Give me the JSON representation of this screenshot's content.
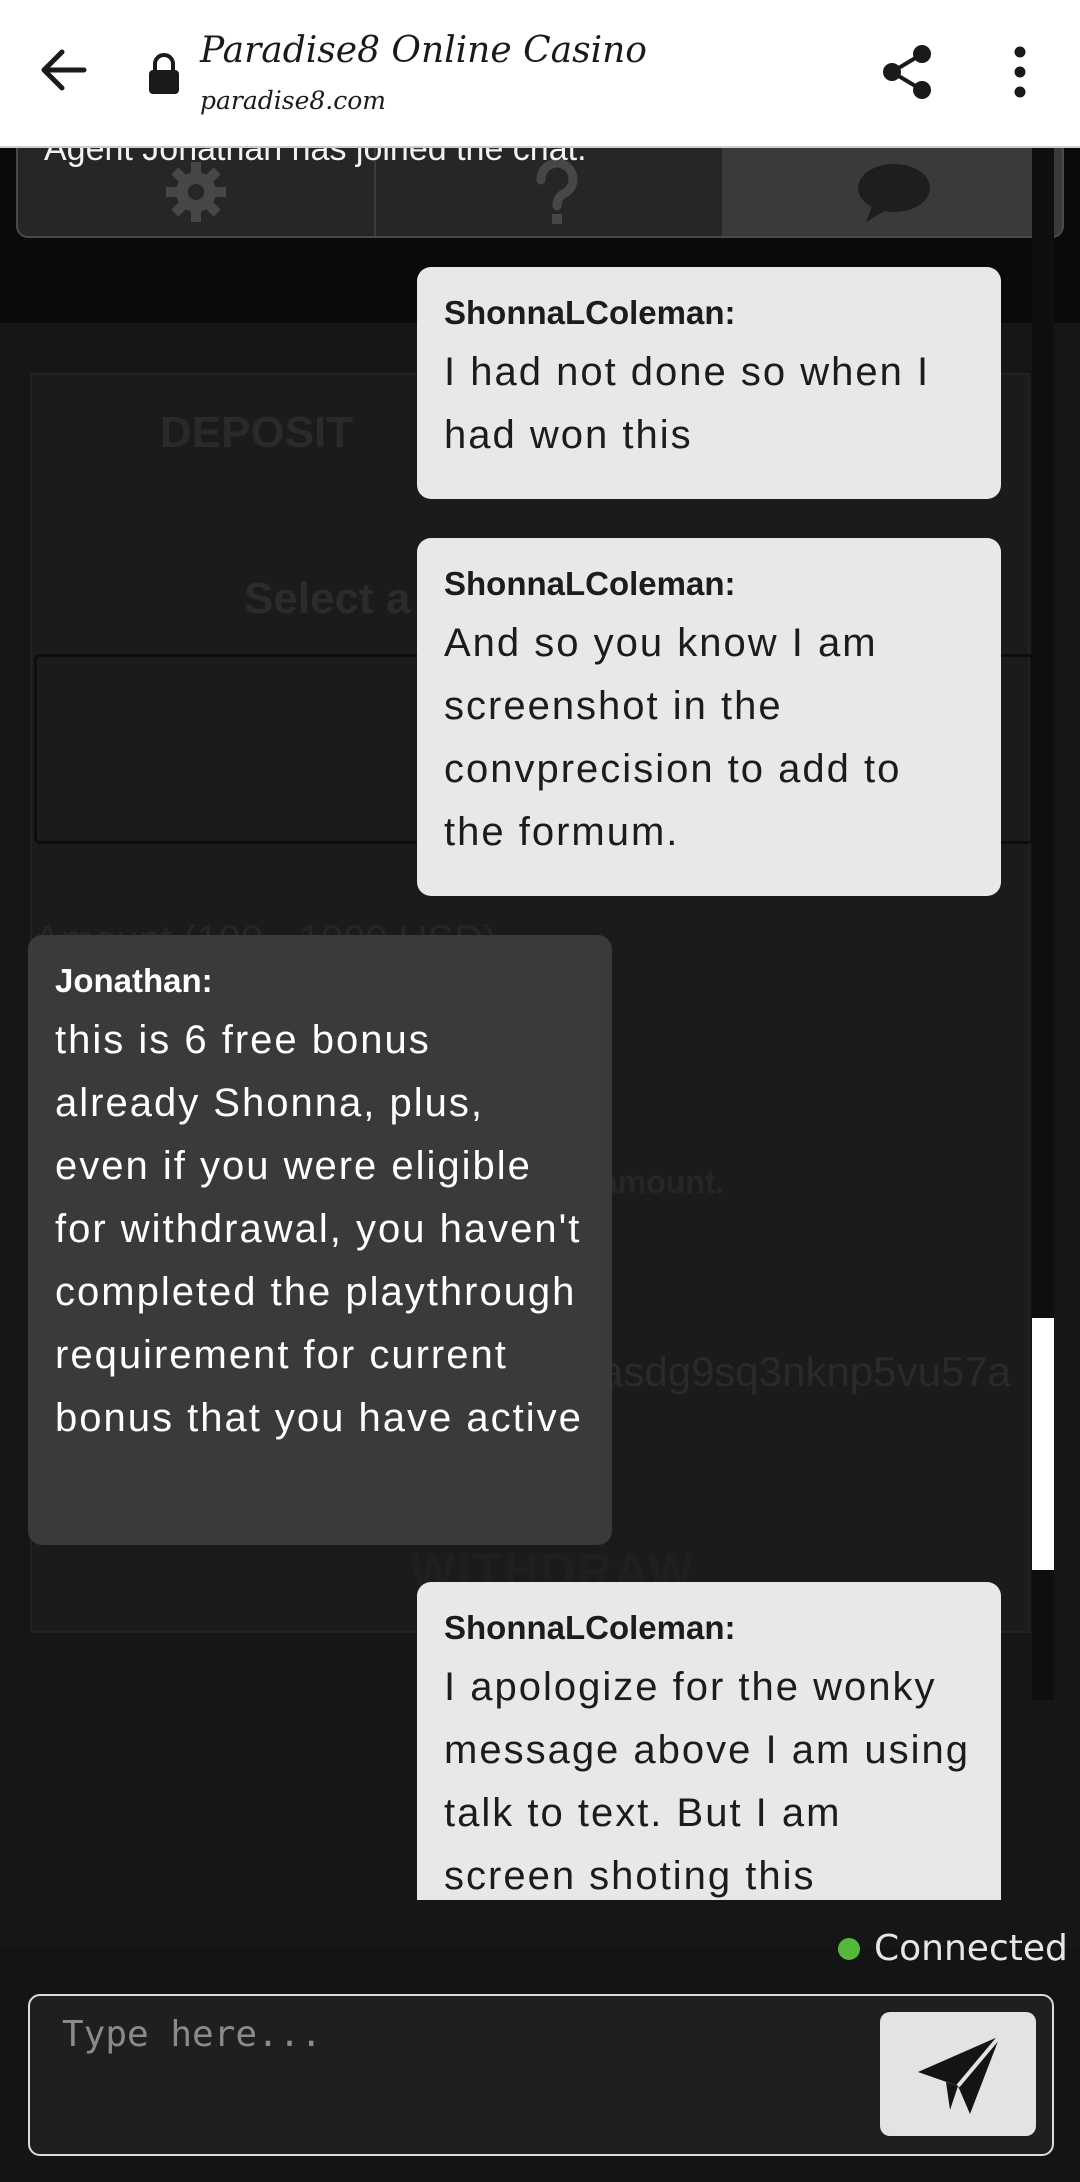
{
  "browser": {
    "title": "Paradise8 Online Casino",
    "url": "paradise8.com",
    "icons": [
      "back-arrow-icon",
      "lock-icon",
      "share-icon",
      "more-vert-icon"
    ]
  },
  "background_page": {
    "deposit_label": "DEPOSIT",
    "select_label": "Select a",
    "amount_label": "Amount (100 - 1000 USD)",
    "amount_hint": "amount.",
    "code_fragment": "asdg9sq3nknp5vu57a",
    "withdraw_label": "WITHDRAW"
  },
  "chat_tabs": {
    "icons": [
      "gear-icon",
      "help-icon",
      "chat-bubble-icon"
    ],
    "active": "chat"
  },
  "system_notice": "Agent Jonathan has joined the chat.",
  "messages": [
    {
      "sender": "ShonnaLColeman:",
      "role": "user",
      "text": "I had not done so when I had won this"
    },
    {
      "sender": "ShonnaLColeman:",
      "role": "user",
      "text": "And so you know I am screenshot in the convprecision to add to the formum."
    },
    {
      "sender": "Jonathan:",
      "role": "agent",
      "text": "this is 6 free bonus already Shonna, plus, even if you were eligible for withdrawal, you haven't completed the playthrough requirement for current bonus that you have active"
    },
    {
      "sender": "ShonnaLColeman:",
      "role": "user",
      "text": "I apologize for the wonky message above I am using talk to text. But I am screen shoting this"
    }
  ],
  "status": {
    "text": "Connected",
    "color": "#55b83a"
  },
  "composer": {
    "placeholder": "Type here...",
    "send_icon": "send-icon"
  }
}
